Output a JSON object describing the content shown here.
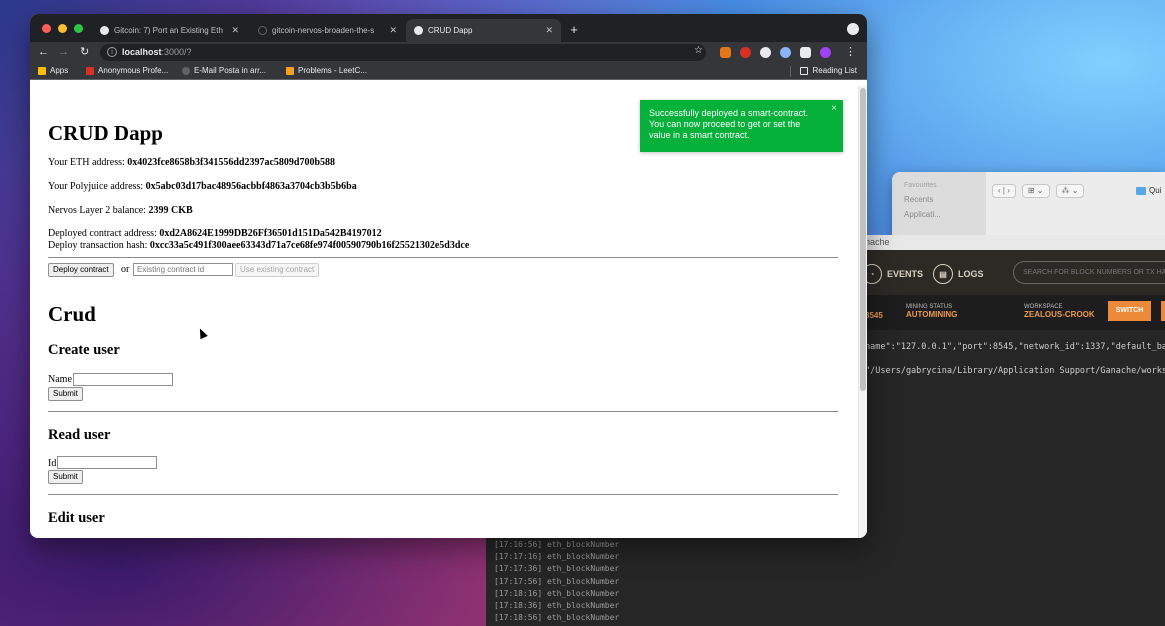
{
  "finder": {
    "section": "Favourites",
    "items": [
      "Recents",
      "Applicati..."
    ],
    "view_btn1": "⊞ ⌄",
    "view_btn2": "⁂ ⌄",
    "folder": "Qui"
  },
  "ganache": {
    "title": "nache",
    "nav": {
      "events": "EVENTS",
      "logs": "LOGS",
      "search_placeholder": "SEARCH FOR BLOCK NUMBERS OR TX HA"
    },
    "status": {
      "port_fragment": "8545",
      "mining_label": "MINING STATUS",
      "mining_value": "AUTOMINING",
      "workspace_label": "WORKSPACE",
      "workspace_value": "ZEALOUS-CROOK",
      "switch_label": "SWITCH"
    },
    "log_line_1": "name\":\"127.0.0.1\",\"port\":8545,\"network_id\":1337,\"default_ba",
    "log_line_2": "\"/Users/gabrycina/Library/Application Support/Ganache/works",
    "log_lines": [
      "[17:16:56] eth_blockNumber",
      "[17:17:16] eth_blockNumber",
      "[17:17:36] eth_blockNumber",
      "[17:17:56] eth_blockNumber",
      "[17:18:16] eth_blockNumber",
      "[17:18:36] eth_blockNumber",
      "[17:18:56] eth_blockNumber"
    ]
  },
  "browser": {
    "tabs": [
      {
        "label": "Gitcoin: 7) Port an Existing Eth"
      },
      {
        "label": "gitcoin-nervos-broaden-the-s"
      },
      {
        "label": "CRUD Dapp"
      }
    ],
    "url_host": "localhost",
    "url_path": ":3000/?",
    "bookmarks": [
      {
        "label": "Apps"
      },
      {
        "label": "Anonymous Profe..."
      },
      {
        "label": "E-Mail Posta in arr..."
      },
      {
        "label": "Problems - LeetC..."
      }
    ],
    "reading_list": "Reading List"
  },
  "dapp": {
    "title": "CRUD Dapp",
    "eth_label": "Your ETH address: ",
    "eth_value": "0x4023fce8658b3f341556dd2397ac5809d700b588",
    "poly_label": "Your Polyjuice address: ",
    "poly_value": "0x5abc03d17bac48956acbbf4863a3704cb3b5b6ba",
    "balance_label": "Nervos Layer 2 balance: ",
    "balance_value": "2399 CKB",
    "contract_label": "Deployed contract address: ",
    "contract_value": "0xd2A8624E1999DB26Ff36501d151Da542B4197012",
    "tx_label": "Deploy transaction hash: ",
    "tx_value": "0xcc33a5c491f300aee63343d71a7ce68fe974f00590790b16f25521302e5d3dce",
    "deploy_button": "Deploy contract",
    "or_text": "or",
    "contract_id_placeholder": "Existing contract id",
    "use_existing_button": "Use existing contract",
    "section_title": "Crud",
    "create_title": "Create user",
    "name_label": "Name",
    "submit_label": "Submit",
    "read_title": "Read user",
    "id_label": "Id",
    "edit_title": "Edit user"
  },
  "toast": {
    "message": "Successfully deployed a smart-contract. You can now proceed to get or set the value in a smart contract.",
    "close": "×",
    "color": "#05b13a"
  }
}
